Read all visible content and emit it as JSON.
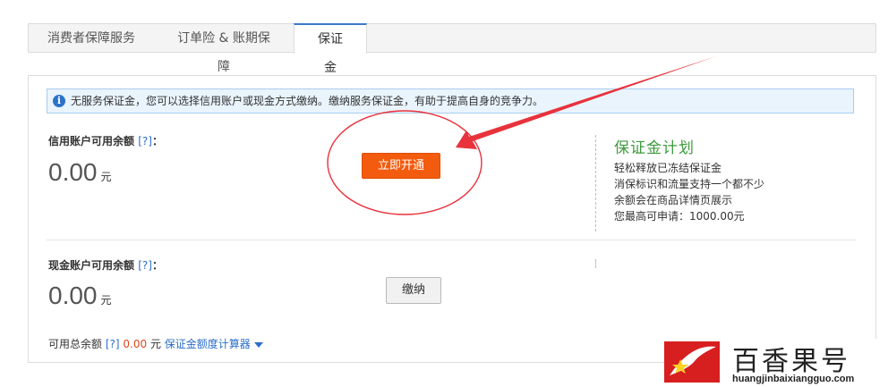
{
  "tabs": [
    {
      "label": "消费者保障服务"
    },
    {
      "label": "订单险 & 账期保障"
    },
    {
      "label": "保证金"
    }
  ],
  "info": {
    "text": "无服务保证金，您可以选择信用账户或现金方式缴纳。缴纳服务保证金，有助于提高自身的竞争力。"
  },
  "credit": {
    "label": "信用账户可用余额",
    "help": "[?]",
    "colon": "：",
    "amount": "0.00",
    "unit": "元",
    "button": "立即开通"
  },
  "cash": {
    "label": "现金账户可用余额",
    "help": "[?]",
    "colon": "：",
    "amount": "0.00",
    "unit": "元",
    "button": "缴纳"
  },
  "plan": {
    "title": "保证金计划",
    "lines": [
      "轻松释放已冻结保证金",
      "消保标识和流量支持一个都不少",
      "余额会在商品详情页展示",
      "您最高可申请：1000.00元"
    ]
  },
  "footer": {
    "label": "可用总余额",
    "help": "[?]",
    "value": "0.00",
    "unit": "元",
    "link": "保证金额度计算器"
  },
  "watermark": {
    "name": "百香果号",
    "url": "huangjinbaixiangguo.com"
  },
  "colors": {
    "primary_button": "#f35b0e",
    "link": "#2b6ecb",
    "annotation": "#e8323c",
    "plan_title": "#3d9a3d"
  }
}
